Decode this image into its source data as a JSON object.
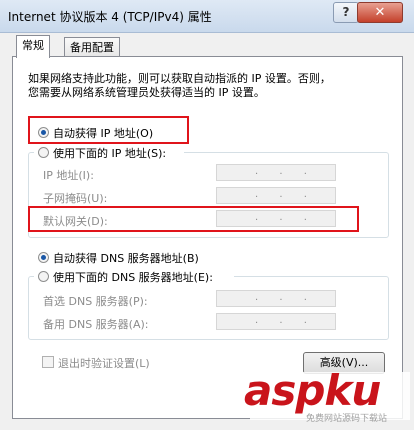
{
  "window": {
    "title": "Internet 协议版本 4 (TCP/IPv4) 属性",
    "help_label": "?",
    "close_label": "✕"
  },
  "tabs": [
    {
      "label": "常规",
      "active": true
    },
    {
      "label": "备用配置",
      "active": false
    }
  ],
  "description": [
    "如果网络支持此功能，则可以获取自动指派的 IP 设置。否则，",
    "您需要从网络系统管理员处获得适当的 IP 设置。"
  ],
  "ip": {
    "auto_label": "自动获得 IP 地址(O)",
    "manual_label": "使用下面的 IP 地址(S):",
    "selected": "auto",
    "fields": [
      {
        "label": "IP 地址(I):",
        "value": ". . ."
      },
      {
        "label": "子网掩码(U):",
        "value": ". . ."
      },
      {
        "label": "默认网关(D):",
        "value": ". . ."
      }
    ]
  },
  "dns": {
    "auto_label": "自动获得 DNS 服务器地址(B)",
    "manual_label": "使用下面的 DNS 服务器地址(E):",
    "selected": "auto",
    "fields": [
      {
        "label": "首选 DNS 服务器(P):",
        "value": ". . ."
      },
      {
        "label": "备用 DNS 服务器(A):",
        "value": ". . ."
      }
    ]
  },
  "validate_label": "退出时验证设置(L)",
  "advanced_label": "高级(V)...",
  "watermark": {
    "brand": "aspku",
    "tagline": "免费网站源码下载站"
  },
  "colors": {
    "highlight": "#e0141b",
    "watermark": "#c9141b"
  }
}
